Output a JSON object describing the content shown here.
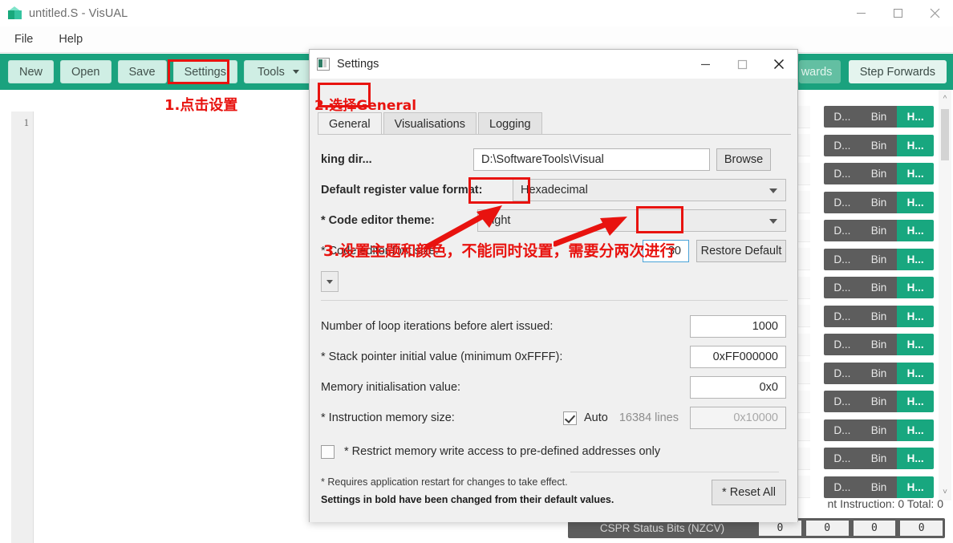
{
  "main_window": {
    "title": "untitled.S - VisUAL",
    "app_icon": "cube-icon",
    "controls": {
      "minimize": "minimize-icon",
      "maximize": "maximize-icon",
      "close": "close-icon"
    },
    "menu": [
      "File",
      "Help"
    ],
    "toolbar": {
      "buttons": [
        "New",
        "Open",
        "Save",
        "Settings"
      ],
      "tools_label": "Tools",
      "right_buttons": [
        "wards",
        "Step Forwards"
      ]
    },
    "editor": {
      "line_number": "1"
    },
    "register_panel": {
      "segments": [
        "D...",
        "Bin",
        "H..."
      ],
      "active_segment": "H...",
      "row_count": 14
    },
    "status": {
      "instruction_text": "nt Instruction:  0  Total:  0",
      "cpsr_label": "CSPR Status Bits (NZCV)",
      "cpsr_values": [
        "0",
        "0",
        "0",
        "0"
      ]
    }
  },
  "settings_dialog": {
    "title": "Settings",
    "icon": "settings-window-icon",
    "controls": {
      "minimize": "minimize-icon",
      "maximize": "maximize-icon",
      "close": "close-icon"
    },
    "tabs": [
      {
        "label": "General",
        "active": true
      },
      {
        "label": "Visualisations",
        "active": false
      },
      {
        "label": "Logging",
        "active": false
      }
    ],
    "fields": {
      "working_dir": {
        "label": "king dir...",
        "value": "D:\\SoftwareTools\\Visual",
        "browse_label": "Browse"
      },
      "register_format": {
        "label": "Default register value format:",
        "value": "Hexadecimal",
        "bold": true
      },
      "editor_theme": {
        "label": "* Code editor theme:",
        "value": "Light",
        "bold": true
      },
      "editor_font_size": {
        "label": "* Code editor font size:",
        "value": "30",
        "restore_label": "Restore Default"
      },
      "loop_iterations": {
        "label": "Number of loop iterations before alert issued:",
        "value": "1000"
      },
      "stack_pointer": {
        "label": "* Stack pointer initial value (minimum 0xFFFF):",
        "value": "0xFF000000"
      },
      "memory_init": {
        "label": "Memory initialisation value:",
        "value": "0x0"
      },
      "instruction_memory": {
        "label": "* Instruction memory size:",
        "auto_label": "Auto",
        "auto_checked": true,
        "lines_label": "16384 lines",
        "size_value": "0x10000"
      },
      "restrict_memory": {
        "label": "* Restrict memory write access to pre-defined addresses only",
        "checked": false
      }
    },
    "footer": {
      "note1": "* Requires application restart for changes to take effect.",
      "note2": "Settings in bold have been changed from their default values.",
      "reset_label": "* Reset All"
    }
  },
  "annotations": {
    "color": "#e8130f",
    "step1": "1.点击设置",
    "step2": "2.选择General",
    "step3": "3.设置主题和颜色，不能同时设置，需要分两次进行"
  }
}
